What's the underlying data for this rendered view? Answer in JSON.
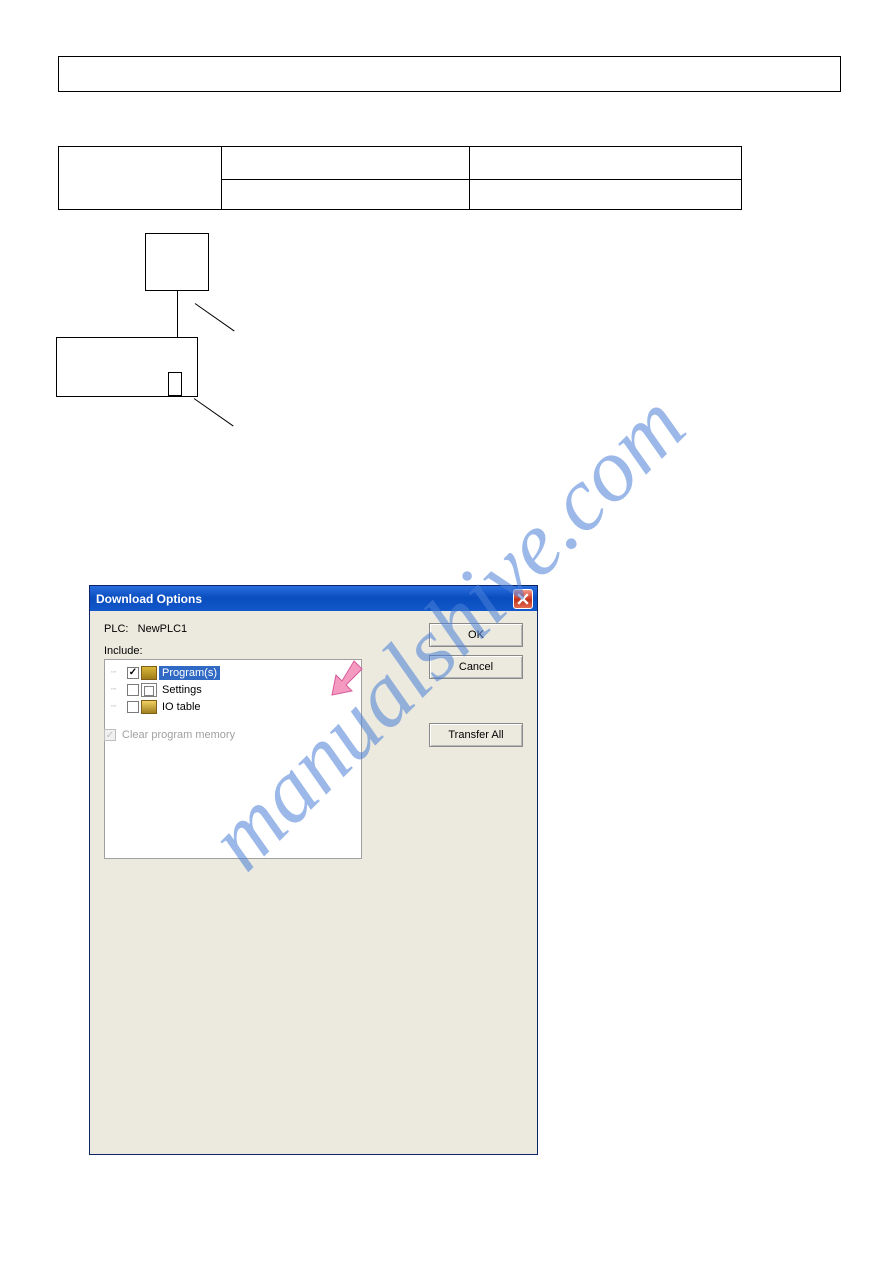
{
  "watermark": "manualshive.com",
  "dialog": {
    "title": "Download Options",
    "plc_label": "PLC:",
    "plc_value": "NewPLC1",
    "include_label": "Include:",
    "tree": {
      "programs": {
        "label": "Program(s)",
        "checked": true,
        "selected": true
      },
      "settings": {
        "label": "Settings",
        "checked": false,
        "selected": false
      },
      "io_table": {
        "label": "IO table",
        "checked": false,
        "selected": false
      }
    },
    "buttons": {
      "ok": "OK",
      "cancel": "Cancel",
      "transfer_all": "Transfer All"
    },
    "clear_memory": "Clear program memory"
  }
}
